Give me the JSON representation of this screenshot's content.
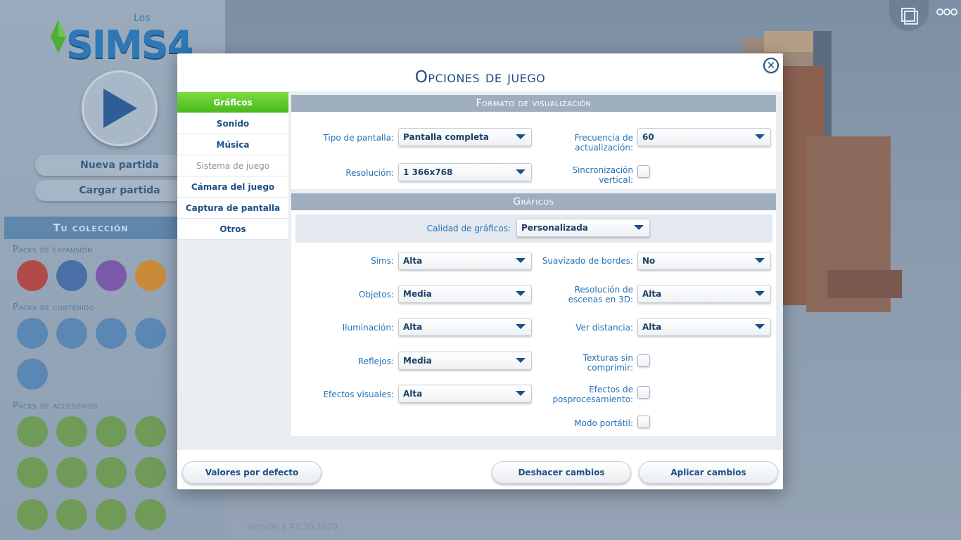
{
  "background": {
    "logo_los": "Los",
    "logo_sims": "SIMS4",
    "menu": {
      "new_game": "Nueva partida",
      "load_game": "Cargar partida"
    },
    "collection_title": "Tu colección",
    "packs": {
      "expansion": "Packs de expansión",
      "content": "Packs de contenido",
      "accessories": "Packs de accesorios"
    },
    "version": "Versión 1.42.30.1020"
  },
  "dialog": {
    "title": "Opciones de juego",
    "close_icon": "close-icon",
    "tabs": [
      {
        "label": "Gráficos",
        "state": "active"
      },
      {
        "label": "Sonido",
        "state": "normal"
      },
      {
        "label": "Música",
        "state": "normal"
      },
      {
        "label": "Sistema de juego",
        "state": "disabled"
      },
      {
        "label": "Cámara del juego",
        "state": "normal"
      },
      {
        "label": "Captura de pantalla",
        "state": "normal"
      },
      {
        "label": "Otros",
        "state": "normal"
      }
    ],
    "display": {
      "header": "Formato de visualización",
      "screen_type_label": "Tipo de pantalla:",
      "screen_type_value": "Pantalla completa",
      "refresh_label": "Frecuencia de actualización:",
      "refresh_value": "60",
      "resolution_label": "Resolución:",
      "resolution_value": "1 366x768",
      "vsync_label": "Sincronización vertical:",
      "vsync_checked": false
    },
    "graphics": {
      "header": "Gráficos",
      "quality_label": "Calidad de gráficos:",
      "quality_value": "Personalizada",
      "sims_label": "Sims:",
      "sims_value": "Alta",
      "objects_label": "Objetos:",
      "objects_value": "Media",
      "lighting_label": "Iluminación:",
      "lighting_value": "Alta",
      "reflections_label": "Reflejos:",
      "reflections_value": "Media",
      "effects_label": "Efectos visuales:",
      "effects_value": "Alta",
      "aa_label": "Suavizado de bordes:",
      "aa_value": "No",
      "res3d_label": "Resolución de escenas en 3D:",
      "res3d_value": "Alta",
      "viewdist_label": "Ver distancia:",
      "viewdist_value": "Alta",
      "uncompressed_label": "Texturas sin comprimir:",
      "uncompressed_checked": false,
      "postfx_label": "Efectos de posprocesamiento:",
      "postfx_checked": false,
      "laptop_label": "Modo portátil:",
      "laptop_checked": false
    },
    "footer": {
      "defaults": "Valores por defecto",
      "undo": "Deshacer cambios",
      "apply": "Aplicar cambios"
    }
  },
  "colors": {
    "accent": "#1d4f86",
    "label_blue": "#2472b8",
    "active_tab": "#49b81c",
    "section_header": "#9faebf"
  }
}
